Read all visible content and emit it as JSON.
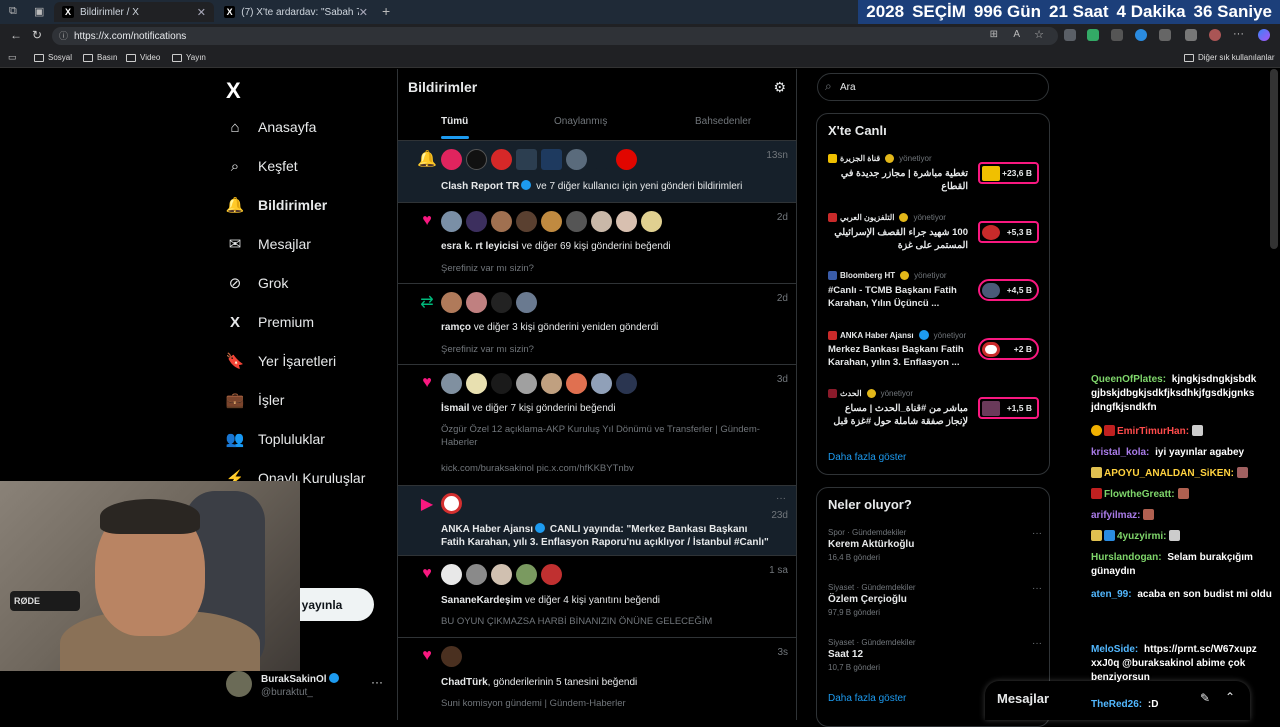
{
  "browser": {
    "tabs": [
      {
        "title": "Bildirimler / X",
        "favicon": "X"
      },
      {
        "title": "(7) X'te ardardav: \"Sabah 7 dram...",
        "favicon": "X"
      }
    ],
    "countdown": {
      "year": "2028",
      "label": "SEÇİM",
      "days": "996 Gün",
      "hours": "21 Saat",
      "minutes": "4 Dakika",
      "seconds": "36 Saniye"
    },
    "url": "https://x.com/notifications",
    "bookmarks": [
      "Sosyal",
      "Basın",
      "Video",
      "Yayın"
    ],
    "other_bookmarks": "Diğer sık kullanılanlar"
  },
  "nav": {
    "items": [
      {
        "label": "Anasayfa",
        "icon": "home-icon",
        "glyph": "⌂"
      },
      {
        "label": "Keşfet",
        "icon": "search-icon",
        "glyph": "⌕"
      },
      {
        "label": "Bildirimler",
        "icon": "bell-icon",
        "glyph": "🔔"
      },
      {
        "label": "Mesajlar",
        "icon": "mail-icon",
        "glyph": "✉"
      },
      {
        "label": "Grok",
        "icon": "grok-icon",
        "glyph": "⊘"
      },
      {
        "label": "Premium",
        "icon": "x-premium-icon",
        "glyph": "X"
      },
      {
        "label": "Yer İşaretleri",
        "icon": "bookmark-icon",
        "glyph": "🔖"
      },
      {
        "label": "İşler",
        "icon": "briefcase-icon",
        "glyph": "💼"
      },
      {
        "label": "Topluluklar",
        "icon": "communities-icon",
        "glyph": "👥"
      },
      {
        "label": "Onaylı Kuruluşlar",
        "icon": "lightning-icon",
        "glyph": "⚡"
      },
      {
        "label": "azla",
        "icon": "more-icon",
        "glyph": ""
      }
    ],
    "post_button": "yayınla",
    "profile": {
      "name": "BurakSakinOl",
      "handle": "@buraktut_",
      "more": "···"
    }
  },
  "notifications": {
    "title": "Bildirimler",
    "tabs": [
      "Tümü",
      "Onaylanmış",
      "Bahsedenler"
    ],
    "items": [
      {
        "icon": "bell-icon",
        "time": "13sn",
        "text_bold": "Clash Report TR",
        "text": " ve 7 diğer kullanıcı için yeni gönderi bildirimleri",
        "sub": ""
      },
      {
        "icon": "heart-icon",
        "time": "2d",
        "text_bold": "esra k. rt leyicisi",
        "text": " ve diğer 69 kişi gönderini beğendi",
        "sub": "Şerefiniz var mı sizin?"
      },
      {
        "icon": "retweet-icon",
        "time": "2d",
        "text_bold": "ramço",
        "text": " ve diğer 3 kişi gönderini yeniden gönderdi",
        "sub": "Şerefiniz var mı sizin?"
      },
      {
        "icon": "heart-icon",
        "time": "3d",
        "text_bold": "İsmail",
        "text": " ve diğer 7 kişi gönderini beğendi",
        "sub": "Özgür Özel 12 açıklama-AKP Kuruluş Yıl Dönümü ve Transferler | Gündem-Haberler",
        "sub2": "kick.com/buraksakinol pic.x.com/hfKKBYTnbv"
      },
      {
        "icon": "live-icon",
        "time": "23d",
        "text_bold": "ANKA Haber Ajansı",
        "text": " CANLI yayında: \"Merkez Bankası Başkanı Fatih Karahan, yılı 3. Enflasyon Raporu'nu açıklıyor / İstanbul #Canlı\"",
        "sub": "",
        "more": "···"
      },
      {
        "icon": "heart-icon",
        "time": "1 sa",
        "text_bold": "SananeKardeşim",
        "text": " ve diğer 4 kişi yanıtını beğendi",
        "sub": "BU OYUN ÇIKMAZSA HARBİ BİNANIZIN ÖNÜNE GELECEĞİM"
      },
      {
        "icon": "heart-icon",
        "time": "3s",
        "text_bold": "ChadTürk",
        "text": ", gönderilerinin 5 tanesini beğendi",
        "sub": "Suni komisyon gündemi | Gündem-Haberler"
      }
    ]
  },
  "search": {
    "placeholder": "Ara"
  },
  "live": {
    "title": "X'te Canlı",
    "items": [
      {
        "source": "قناة الجزيرة",
        "host": "yönetiyor",
        "title": "تغطية مباشرة | مجازر جديدة في القطاع",
        "count": "+23,6 B"
      },
      {
        "source": "التلفزيون العربي",
        "host": "yönetiyor",
        "title": "100 شهيد جراء القصف الإسرائيلي المستمر على غزة",
        "count": "+5,3 B"
      },
      {
        "source": "Bloomberg HT",
        "host": "yönetiyor",
        "title": "#Canlı - TCMB Başkanı Fatih Karahan, Yılın Üçüncü ...",
        "count": "+4,5 B"
      },
      {
        "source": "ANKA Haber Ajansı",
        "host": "yönetiyor",
        "title": "Merkez Bankası Başkanı Fatih Karahan, yılın 3. Enflasyon ...",
        "count": "+2 B"
      },
      {
        "source": "الحدث",
        "host": "yönetiyor",
        "title": "مباشر من #قناة_الحدث | مساع لإنجاز صفقة شاملة حول #غزة قبل",
        "count": "+1,5 B"
      }
    ],
    "more": "Daha fazla göster"
  },
  "trends": {
    "title": "Neler oluyor?",
    "items": [
      {
        "category": "Spor · Gündemdekiler",
        "name": "Kerem Aktürkoğlu",
        "count": "16,4 B gönderi"
      },
      {
        "category": "Siyaset · Gündemdekiler",
        "name": "Özlem Çerçioğlu",
        "count": "97,9 B gönderi"
      },
      {
        "category": "Siyaset · Gündemdekiler",
        "name": "Saat 12",
        "count": "10,7 B gönderi"
      }
    ],
    "more": "Daha fazla göster"
  },
  "messages_drawer": {
    "title": "Mesajlar"
  },
  "chat": [
    {
      "user": "QueenOfPlates:",
      "color": "#7fd66b",
      "text": " kjngkjsdngkjsbdk gjbskjdbgkjsdkfjksdhkjfgsdkjgnks jdngfkjsndkfn"
    },
    {
      "user": "EmirTimurHan:",
      "color": "#ff4b4b",
      "text": ""
    },
    {
      "user": "kristal_kola:",
      "color": "#a97be8",
      "text": " iyi yayınlar agabey"
    },
    {
      "user": "APOYU_ANALDAN_SiKEN:",
      "color": "#ffd23f",
      "text": ""
    },
    {
      "user": "FlowtheGreatt:",
      "color": "#7fd66b",
      "text": ""
    },
    {
      "user": "arifyilmaz:",
      "color": "#a97be8",
      "text": ""
    },
    {
      "user": "4yuzyirmi:",
      "color": "#7fd66b",
      "text": ""
    },
    {
      "user": "Hurslandogan:",
      "color": "#7fd66b",
      "text": " Selam burakçığım günaydın"
    },
    {
      "user": "aten_99:",
      "color": "#52b8ff",
      "text": " acaba en son budist mi oldu"
    },
    {
      "user": "MeloSide:",
      "color": "#52b8ff",
      "text": " https://prnt.sc/W67xupz xxJ0q @buraksakinol abime çok benziyorsun"
    },
    {
      "user": "TheRed26:",
      "color": "#52b8ff",
      "text": " :D"
    }
  ],
  "webcam": {
    "mic_label": "RØDE"
  }
}
